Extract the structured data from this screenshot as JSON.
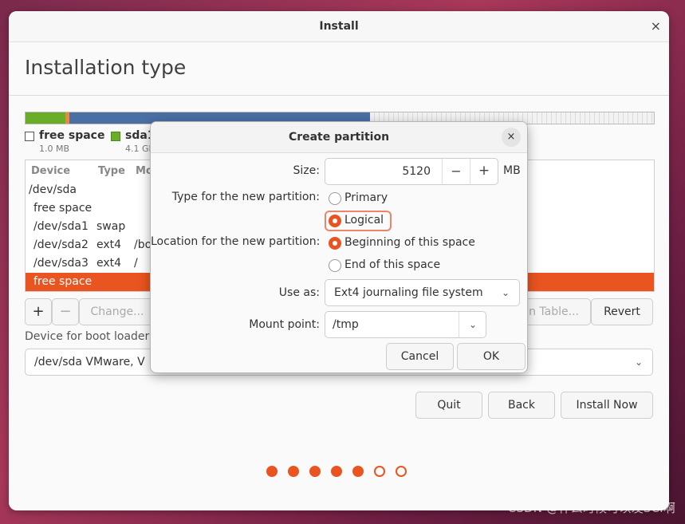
{
  "window": {
    "title": "Install",
    "close_glyph": "×"
  },
  "page": {
    "heading": "Installation type"
  },
  "colors": {
    "accent": "#e95420",
    "free_space_swatch": "#ffffff",
    "sda1_swatch": "#6aae28",
    "sda2_bar": "#e98b3a",
    "sda3_bar": "#4a6fa5"
  },
  "legend": [
    {
      "name": "free space",
      "size": "1.0 MB"
    },
    {
      "name": "sda1",
      "size": "4.1 GB"
    }
  ],
  "table": {
    "headers": [
      "Device",
      "Type",
      "Mo"
    ],
    "rows": [
      {
        "device": "/dev/sda",
        "type": "",
        "mount": ""
      },
      {
        "device": "free space",
        "type": "",
        "mount": ""
      },
      {
        "device": "/dev/sda1",
        "type": "swap",
        "mount": ""
      },
      {
        "device": "/dev/sda2",
        "type": "ext4",
        "mount": "/bo"
      },
      {
        "device": "/dev/sda3",
        "type": "ext4",
        "mount": "/"
      },
      {
        "device": "free space",
        "type": "",
        "mount": ""
      }
    ]
  },
  "toolbar": {
    "add": "+",
    "remove": "−",
    "change": "Change...",
    "new_table": "n Table...",
    "revert": "Revert"
  },
  "boot": {
    "label": "Device for boot loader i",
    "value": "/dev/sda   VMware, V"
  },
  "actions": {
    "quit": "Quit",
    "back": "Back",
    "install": "Install Now"
  },
  "progress": {
    "steps_total": 7,
    "steps_completed": 5
  },
  "dialog": {
    "title": "Create partition",
    "close_glyph": "×",
    "size_label": "Size:",
    "size_value": "5120",
    "size_minus": "−",
    "size_plus": "+",
    "size_unit": "MB",
    "type_label": "Type for the new partition:",
    "type_primary": "Primary",
    "type_logical": "Logical",
    "type_selected": "Logical",
    "location_label": "Location for the new partition:",
    "location_begin": "Beginning of this space",
    "location_end": "End of this space",
    "location_selected": "Beginning of this space",
    "use_as_label": "Use as:",
    "use_as_value": "Ext4 journaling file system",
    "mount_label": "Mount point:",
    "mount_value": "/tmp",
    "cancel": "Cancel",
    "ok": "OK"
  },
  "watermark": "CSDN @什么时候可以发SCI啊"
}
